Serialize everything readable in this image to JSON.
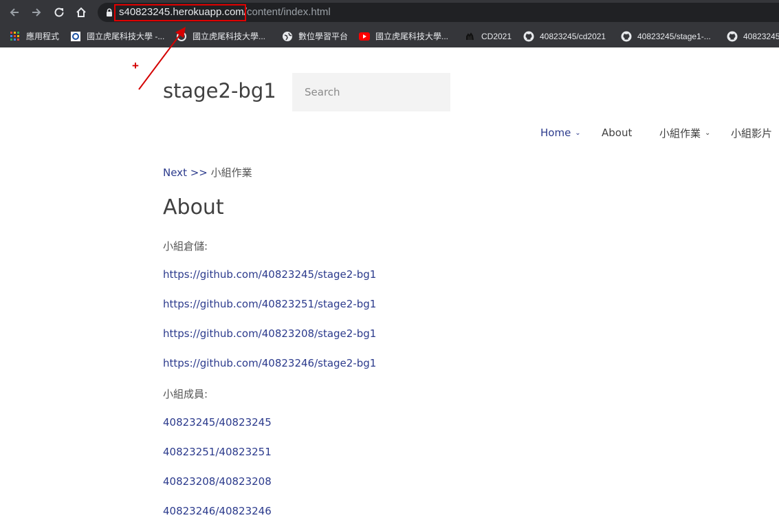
{
  "browser": {
    "url_host": "s40823245.herokuapp.com/",
    "url_path": "content/index.html",
    "bookmarks": [
      {
        "label": "應用程式",
        "icon": "apps-grid-icon"
      },
      {
        "label": "國立虎尾科技大學 -...",
        "icon": "school-icon"
      },
      {
        "label": "國立虎尾科技大學...",
        "icon": "school-icon"
      },
      {
        "label": "數位學習平台",
        "icon": "globe-icon"
      },
      {
        "label": "國立虎尾科技大學...",
        "icon": "youtube-icon"
      },
      {
        "label": "CD2021",
        "icon": "camel-icon"
      },
      {
        "label": "40823245/cd2021",
        "icon": "github-icon"
      },
      {
        "label": "40823245/stage1-...",
        "icon": "github-icon"
      },
      {
        "label": "40823245",
        "icon": "github-icon"
      }
    ]
  },
  "annotation": {
    "marker": "+",
    "color": "#d40000"
  },
  "site": {
    "title": "stage2-bg1",
    "search_placeholder": "Search",
    "nav": [
      {
        "label": "Home",
        "dropdown": true,
        "active": true
      },
      {
        "label": "About",
        "dropdown": false,
        "active": false
      },
      {
        "label": "小組作業",
        "dropdown": true,
        "active": false
      },
      {
        "label": "小組影片",
        "dropdown": false,
        "active": false
      }
    ]
  },
  "content": {
    "breadcrumb_link": "Next",
    "breadcrumb_sep": ">>",
    "breadcrumb_text": "小組作業",
    "heading": "About",
    "repo_label": "小組倉儲:",
    "repos": [
      "https://github.com/40823245/stage2-bg1",
      "https://github.com/40823251/stage2-bg1",
      "https://github.com/40823208/stage2-bg1",
      "https://github.com/40823246/stage2-bg1"
    ],
    "member_label": "小組成員:",
    "members": [
      "40823245/40823245",
      "40823251/40823251",
      "40823208/40823208",
      "40823246/40823246"
    ]
  },
  "colors": {
    "link": "#2b3a8c",
    "text": "#555555",
    "chrome": "#35363a",
    "highlight": "#e00000"
  }
}
